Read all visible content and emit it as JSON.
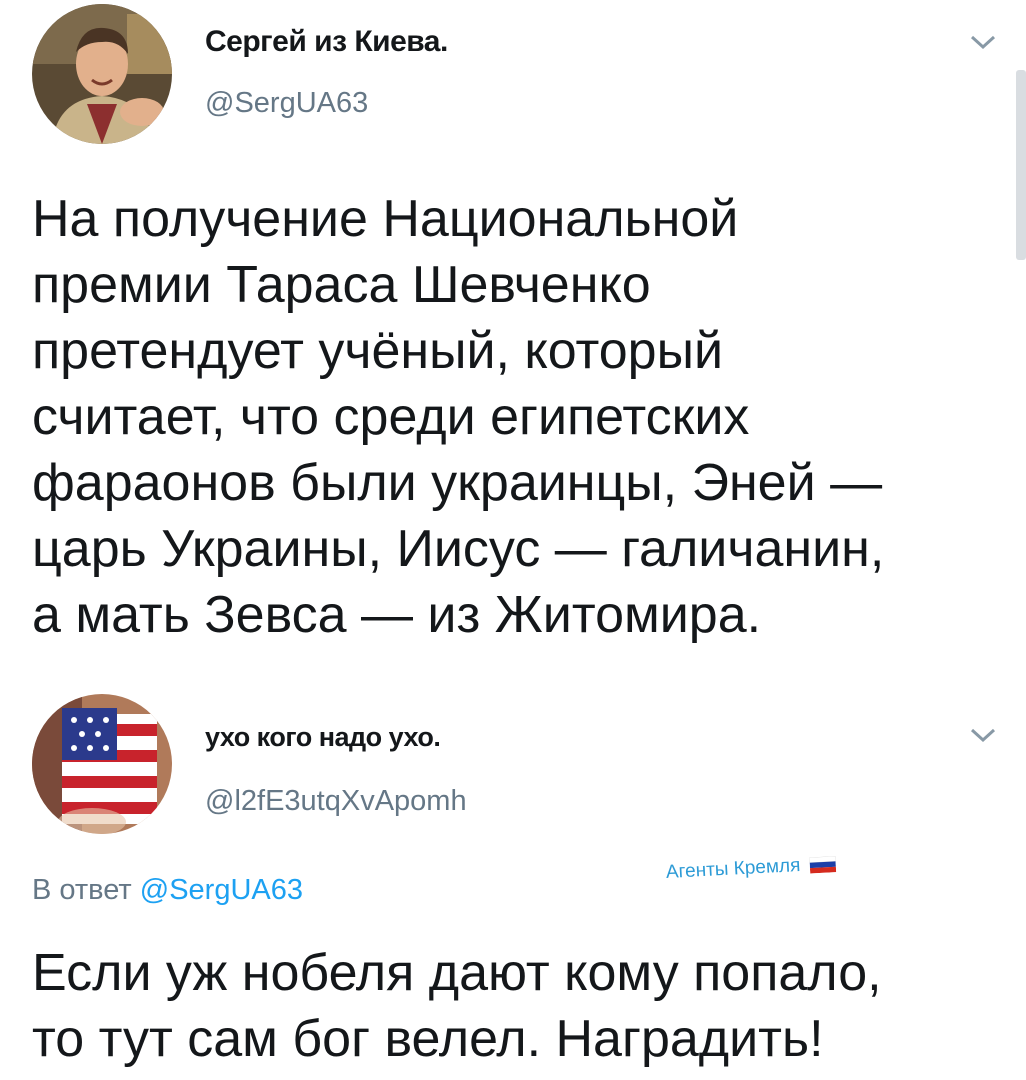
{
  "tweet1": {
    "author_name": "Сергей из Киева.",
    "handle": "@SergUA63",
    "text": "На получение Национальной\nпремии Тараса Шевченко\nпретендует учёный, который\nсчитает, что среди египетских\nфараонов были украинцы, Эней —\nцарь Украины, Иисус — галичанин,\nа мать Зевса — из Житомира.",
    "avatar_icon": "person-avatar-icon",
    "menu_icon": "chevron-down-icon"
  },
  "tweet2": {
    "author_name": "ухо кого надо ухо.",
    "handle": "@l2fE3utqXvApomh",
    "reply_prefix": "В ответ ",
    "reply_handle": "@SergUA63",
    "text": "Если уж нобеля дают кому попало,\nто тут сам бог велел. Наградить!",
    "avatar_icon": "flag-painted-face-avatar-icon",
    "menu_icon": "chevron-down-icon"
  },
  "watermark": {
    "text": "Агенты Кремля",
    "flag_icon": "russian-flag-icon"
  },
  "colors": {
    "text": "#14171a",
    "secondary": "#657786",
    "link": "#1da1f2",
    "watermark": "#2d9bd6"
  }
}
